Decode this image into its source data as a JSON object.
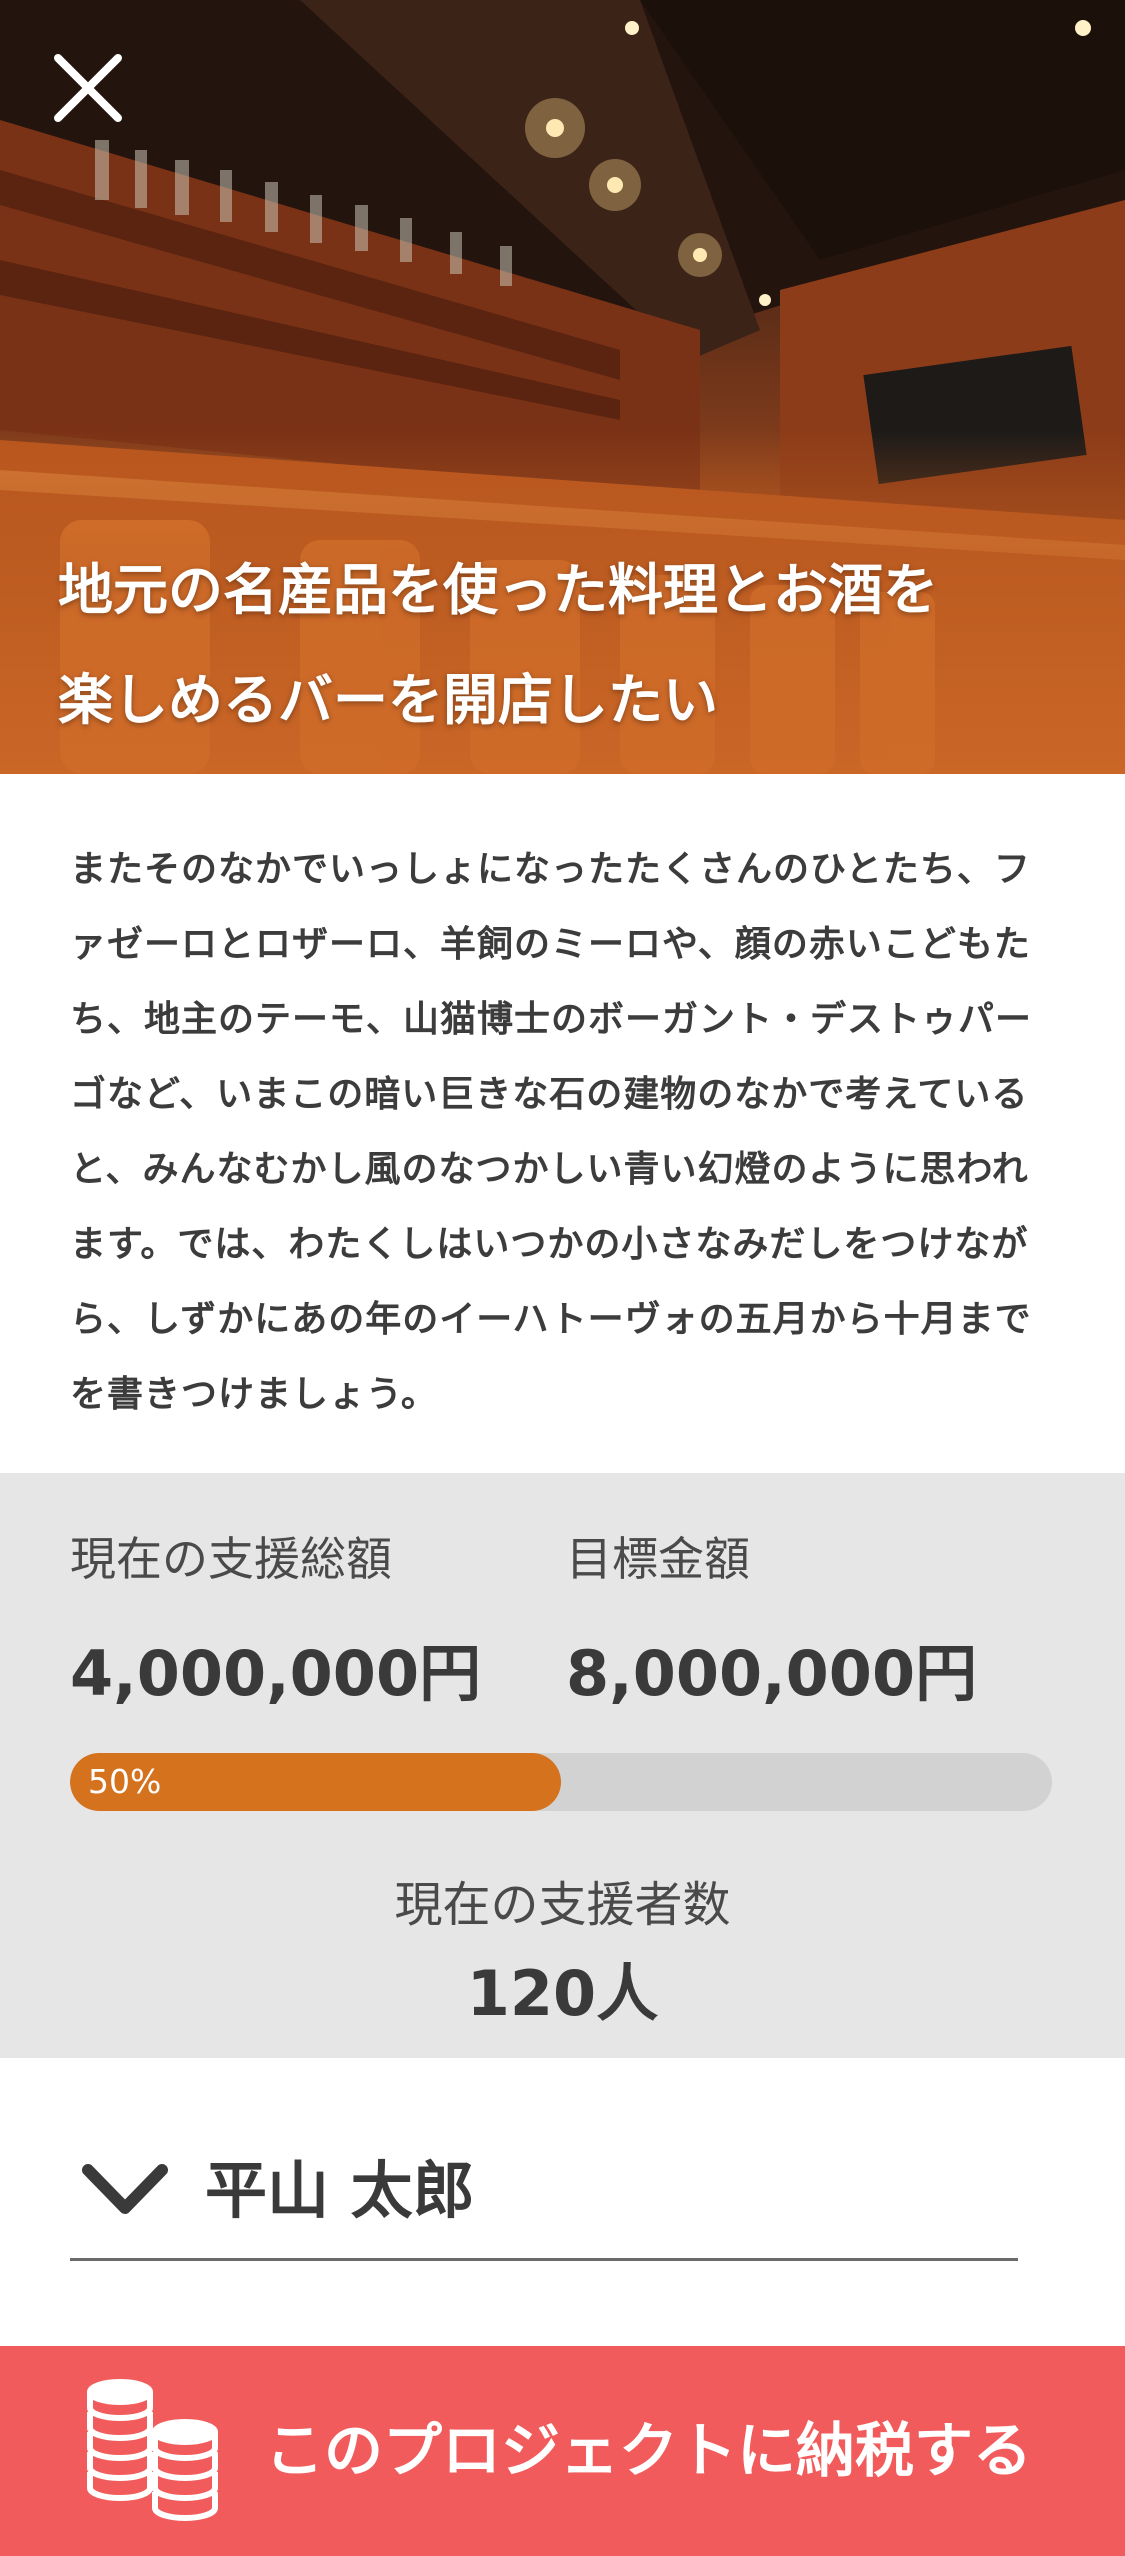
{
  "hero": {
    "title_line1": "地元の名産品を使った料理とお酒を",
    "title_line2": "楽しめるバーを開店したい",
    "close_icon": "close-icon"
  },
  "description": "またそのなかでいっしょになったたくさんのひとたち、ファゼーロとロザーロ、羊飼のミーロや、顔の赤いこどもたち、地主のテーモ、山猫博士のボーガント・デストゥパーゴなど、いまこの暗い巨きな石の建物のなかで考えていると、みんなむかし風のなつかしい青い幻燈のように思われます。では、わたくしはいつかの小さなみだしをつけながら、しずかにあの年のイーハトーヴォの五月から十月までを書きつけましょう。",
  "stats": {
    "current_label": "現在の支援総額",
    "current_value": "4,000,000円",
    "goal_label": "目標金額",
    "goal_value": "8,000,000円",
    "progress_text": "50%",
    "progress": 0.5,
    "supporters_label": "現在の支援者数",
    "supporters_value": "120人"
  },
  "user": {
    "name": "平山 太郎",
    "icon": "chevron-down-icon"
  },
  "cta": {
    "label": "このプロジェクトに納税する",
    "icon": "coins-icon"
  },
  "colors": {
    "accent": "#d4721e",
    "cta": "#f25b5b",
    "stats_bg": "#e6e6e6"
  }
}
